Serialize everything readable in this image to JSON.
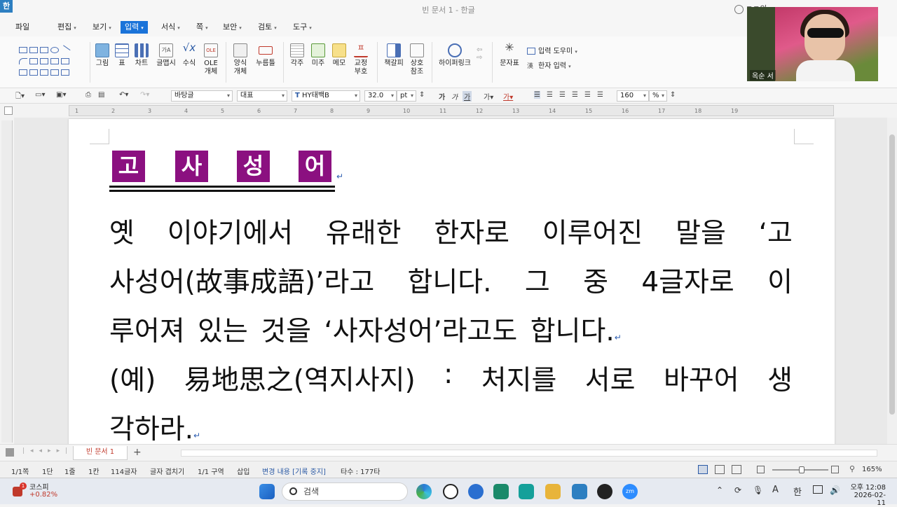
{
  "window": {
    "title": "빈 문서 1 - 한글",
    "app_logo": "한",
    "account": "ㅋㅋ의"
  },
  "menu": [
    {
      "label": "파일"
    },
    {
      "label": "편집"
    },
    {
      "label": "보기"
    },
    {
      "label": "입력"
    },
    {
      "label": "서식"
    },
    {
      "label": "쪽"
    },
    {
      "label": "보안"
    },
    {
      "label": "검토"
    },
    {
      "label": "도구"
    }
  ],
  "ribbon": {
    "buttons": [
      {
        "label": "그림"
      },
      {
        "label": "표"
      },
      {
        "label": "차트"
      },
      {
        "label": "글맵시"
      },
      {
        "label": "수식"
      },
      {
        "label": "OLE\n개체"
      },
      {
        "label": "양식\n개체"
      },
      {
        "label": "누름틀"
      },
      {
        "label": "각주"
      },
      {
        "label": "미주"
      },
      {
        "label": "메모"
      },
      {
        "label": "교정\n부호"
      },
      {
        "label": "책갈피"
      },
      {
        "label": "상호\n참조"
      },
      {
        "label": "하이퍼링크"
      },
      {
        "label": "문자표"
      }
    ],
    "input_helper": "입력 도우미",
    "hanja_input": "한자 입력"
  },
  "format": {
    "style": "바탕글",
    "lang": "대표",
    "font": "HY태백B",
    "size": "32.0",
    "unit": "pt",
    "line_spacing": "160",
    "line_unit": "%"
  },
  "ruler_ticks": [
    "1",
    "2",
    "3",
    "4",
    "5",
    "6",
    "7",
    "8",
    "9",
    "10",
    "11",
    "12",
    "13",
    "14",
    "15",
    "16",
    "17",
    "18",
    "19"
  ],
  "document": {
    "title_chars": [
      "고",
      "사",
      "성",
      "어"
    ],
    "lines": [
      [
        "옛",
        "이야기에서",
        "유래한",
        "한자로",
        "이루어진",
        "말을",
        "‘고"
      ],
      [
        "사성어(故事成語)’라고",
        "합니다.",
        "그",
        "중",
        "4글자로",
        "이"
      ],
      [
        "루어져 있는 것을 ‘사자성어’라고도 합니다."
      ],
      [
        "(예)",
        "易地思之(역지사지)",
        ":",
        "처지를",
        "서로",
        "바꾸어",
        "생"
      ],
      [
        "각하라."
      ]
    ]
  },
  "tabs": {
    "doc_tab": "빈 문서 1",
    "add": "+"
  },
  "status": {
    "page": "1/1쪽",
    "column": "1단",
    "line": "1줄",
    "col": "1칸",
    "chars": "114글자",
    "overwrite": "글자 겹치기",
    "section": "1/1 구역",
    "insert": "삽입",
    "track": "변경 내용 [기록 중지]",
    "typing": "타수 : 177타",
    "zoom": "165%"
  },
  "taskbar": {
    "stock_name": "코스피",
    "stock_change": "+0.82%",
    "search_placeholder": "검색",
    "ime": "한",
    "time": "오후 12:08",
    "date": "2026-02-11",
    "lang_a": "A"
  },
  "video": {
    "name": "옥순 서"
  },
  "colors": {
    "title_box": "#8b1080",
    "accent": "#1a73d9",
    "para_mark": "#2c5db0"
  }
}
